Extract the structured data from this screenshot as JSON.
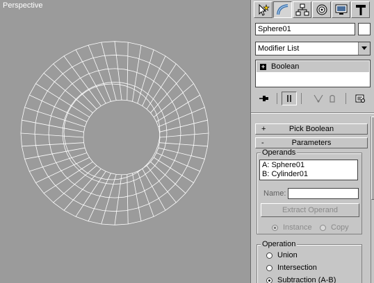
{
  "viewport": {
    "label": "Perspective",
    "background": "#9b9b9b",
    "wire_color": "#ffffff"
  },
  "panel": {
    "tabs": [
      {
        "name": "create-tab",
        "icon": "cursor-star-icon"
      },
      {
        "name": "modify-tab",
        "icon": "modify-bend-icon",
        "active": true
      },
      {
        "name": "hierarchy-tab",
        "icon": "hierarchy-icon"
      },
      {
        "name": "motion-tab",
        "icon": "motion-icon"
      },
      {
        "name": "display-tab",
        "icon": "display-monitor-icon"
      },
      {
        "name": "utilities-tab",
        "icon": "hammer-icon"
      }
    ],
    "object_name": "Sphere01",
    "modifier_list": "Modifier List",
    "stack_item": "Boolean",
    "stack_item_toggle": "+"
  },
  "pick_boolean": {
    "sign": "+",
    "title": "Pick Boolean"
  },
  "parameters": {
    "sign": "-",
    "title": "Parameters",
    "operands_group": "Operands",
    "operand_a": "A: Sphere01",
    "operand_b": "B: Cylinder01",
    "name_label": "Name:",
    "name_value": "",
    "extract_button": "Extract Operand",
    "instance_label": "Instance",
    "copy_label": "Copy",
    "operation_group": "Operation",
    "union_label": "Union",
    "intersection_label": "Intersection",
    "subtraction_label": "Subtraction (A-B)"
  }
}
